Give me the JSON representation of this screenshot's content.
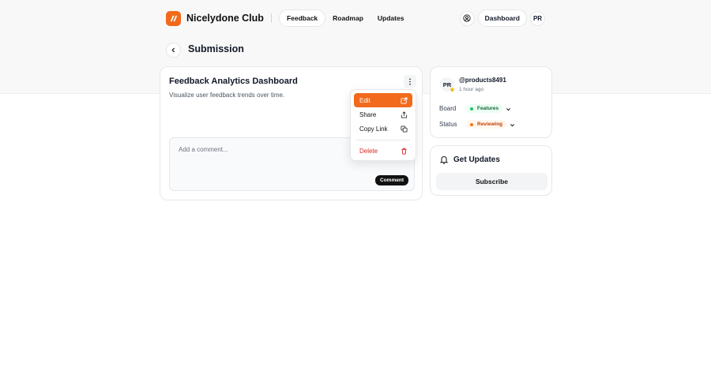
{
  "header": {
    "brand": "Nicelydone Club",
    "nav": [
      {
        "label": "Feedback",
        "active": true
      },
      {
        "label": "Roadmap",
        "active": false
      },
      {
        "label": "Updates",
        "active": false
      }
    ],
    "dashboard_label": "Dashboard",
    "user_initials": "PR",
    "icons": {
      "logo": "brand-logo-icon",
      "account": "user-circle-icon"
    }
  },
  "page": {
    "title": "Submission",
    "back_icon": "chevron-left-icon"
  },
  "post": {
    "title": "Feedback Analytics Dashboard",
    "description": "Visualize user feedback trends over time.",
    "more_icon": "more-vertical-icon",
    "comment_placeholder": "Add a comment...",
    "comment_button": "Comment"
  },
  "menu": {
    "items": [
      {
        "label": "Edit",
        "icon": "external-edit-icon",
        "highlighted": true
      },
      {
        "label": "Share",
        "icon": "share-icon"
      },
      {
        "label": "Copy Link",
        "icon": "copy-icon"
      }
    ],
    "delete": {
      "label": "Delete",
      "icon": "trash-icon"
    }
  },
  "meta": {
    "initials": "PR",
    "username": "@products8491",
    "time": "1 hour ago",
    "board_label": "Board",
    "board_value": "Features",
    "status_label": "Status",
    "status_value": "Reviewing"
  },
  "updates": {
    "title": "Get Updates",
    "subscribe": "Subscribe"
  },
  "colors": {
    "accent": "#f26a1b",
    "features_green": "#22c55e",
    "reviewing_orange": "#f97316",
    "danger": "#dc2626"
  }
}
